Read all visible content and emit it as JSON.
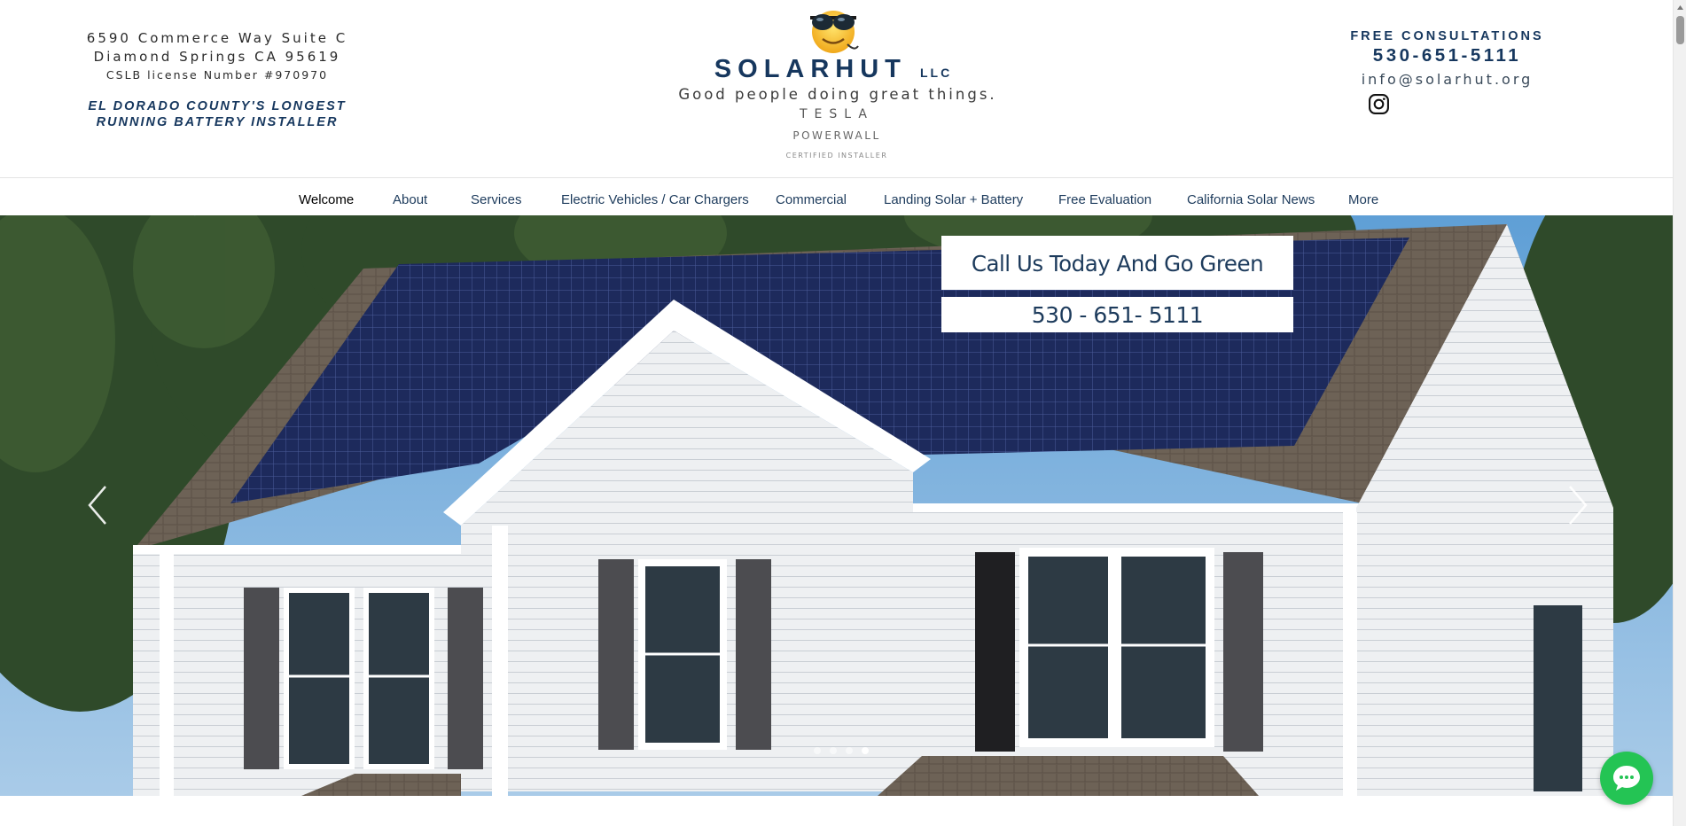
{
  "header": {
    "address_line1": "6590 Commerce Way Suite C",
    "address_line2": "Diamond Springs CA 95619",
    "license": "CSLB license Number #970970",
    "tagline_line1": "EL DORADO COUNTY'S LONGEST",
    "tagline_line2": "RUNNING BATTERY INSTALLER",
    "brand_name": "SOLARHUT",
    "brand_suffix": "LLC",
    "slogan": "Good people doing great things.",
    "badge_tesla": "TESLA",
    "badge_powerwall": "POWERWALL",
    "badge_certified": "CERTIFIED INSTALLER",
    "free_consultations": "FREE CONSULTATIONS",
    "phone": "530-651-5111",
    "email": "info@solarhut.org",
    "social_icon": "instagram-icon"
  },
  "nav": {
    "items": [
      {
        "label": "Welcome",
        "active": true
      },
      {
        "label": "About"
      },
      {
        "label": "Services"
      },
      {
        "label": "Electric Vehicles / Car Chargers"
      },
      {
        "label": "Commercial"
      },
      {
        "label": "Landing Solar + Battery"
      },
      {
        "label": "Free Evaluation"
      },
      {
        "label": "California Solar News"
      },
      {
        "label": "More"
      }
    ]
  },
  "hero": {
    "cta_title": "Call Us Today And Go Green",
    "cta_phone": "530 - 651- 5111",
    "slide_count": 4,
    "active_slide": 4
  },
  "colors": {
    "brand_navy": "#16375e",
    "nav_text": "#1d3b5c",
    "chat_green": "#24c454"
  }
}
